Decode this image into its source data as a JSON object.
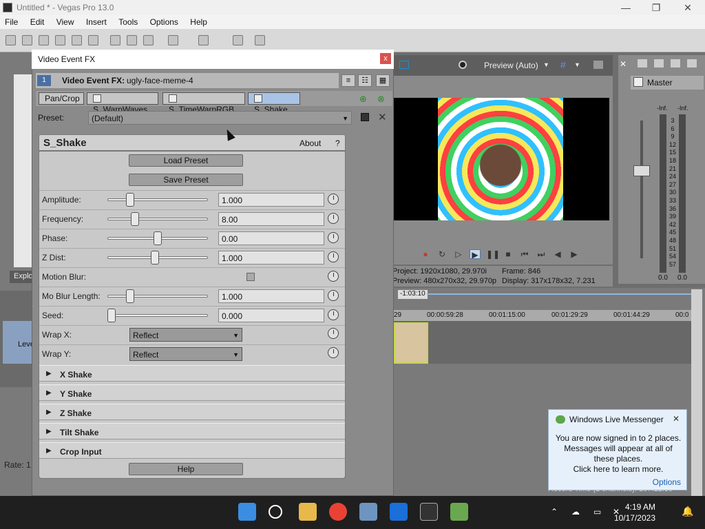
{
  "window": {
    "title": "Untitled * - Vegas Pro 13.0",
    "min_glyph": "—",
    "max_glyph": "❐",
    "close_glyph": "✕"
  },
  "menu": [
    "File",
    "Edit",
    "View",
    "Insert",
    "Tools",
    "Options",
    "Help"
  ],
  "left": {
    "explorer_tab": "Explo",
    "rate_label": "Rate: 1.",
    "track_label": "Leve"
  },
  "preview": {
    "mode": "Preview (Auto)",
    "project_line": "Project:  1920x1080, 29.970i",
    "preview_line": "Preview:  480x270x32, 29.970p",
    "frame_line": "Frame:      846",
    "display_line": "Display:   317x178x32, 7.231"
  },
  "master": {
    "title": "Master",
    "inf_left": "-Inf.",
    "inf_right": "-Inf.",
    "scale": [
      "3",
      "6",
      "9",
      "12",
      "15",
      "18",
      "21",
      "24",
      "27",
      "30",
      "33",
      "36",
      "39",
      "42",
      "45",
      "48",
      "51",
      "54",
      "57"
    ],
    "zero_left": "0.0",
    "zero_right": "0.0"
  },
  "timeline": {
    "cursor_time": "-1:03:10",
    "ticks": [
      "29",
      "00:00:59:28",
      "00:01:15:00",
      "00:01:29:29",
      "00:01:44:29",
      "00:0"
    ],
    "record_time": "Record Time (2 channels): 167:12:30"
  },
  "messenger": {
    "title": "Windows Live Messenger",
    "close": "✕",
    "line1": "You are now signed in to 2 places.",
    "line2": "Messages will appear at all of these places.",
    "line3": "Click here to learn more.",
    "options": "Options"
  },
  "fx": {
    "dialog_title": "Video Event FX",
    "close": "x",
    "header_label": "Video Event FX:",
    "event_name": "ugly-face-meme-4",
    "chain": [
      "Pan/Crop",
      "S_WarpWaves",
      "S_TimeWarpRGB",
      "S_Shake"
    ],
    "preset_label": "Preset:",
    "preset_value": "(Default)"
  },
  "plugin": {
    "name": "S_Shake",
    "about": "About",
    "help_q": "?",
    "load_preset": "Load Preset",
    "save_preset": "Save Preset",
    "params": [
      {
        "label": "Amplitude:",
        "value": "1.000",
        "pos": 0.2
      },
      {
        "label": "Frequency:",
        "value": "8.00",
        "pos": 0.25
      },
      {
        "label": "Phase:",
        "value": "0.00",
        "pos": 0.5
      },
      {
        "label": "Z Dist:",
        "value": "1.000",
        "pos": 0.47
      },
      {
        "label": "Motion Blur:",
        "value": "",
        "pos": null
      },
      {
        "label": "Mo Blur Length:",
        "value": "1.000",
        "pos": 0.2
      },
      {
        "label": "Seed:",
        "value": "0.000",
        "pos": 0.0
      }
    ],
    "wrap_x_label": "Wrap X:",
    "wrap_x_value": "Reflect",
    "wrap_y_label": "Wrap Y:",
    "wrap_y_value": "Reflect",
    "sections": [
      "X Shake",
      "Y Shake",
      "Z Shake",
      "Tilt Shake",
      "Crop Input"
    ],
    "help": "Help"
  },
  "taskbar": {
    "time": "4:19 AM",
    "date": "10/17/2023"
  }
}
